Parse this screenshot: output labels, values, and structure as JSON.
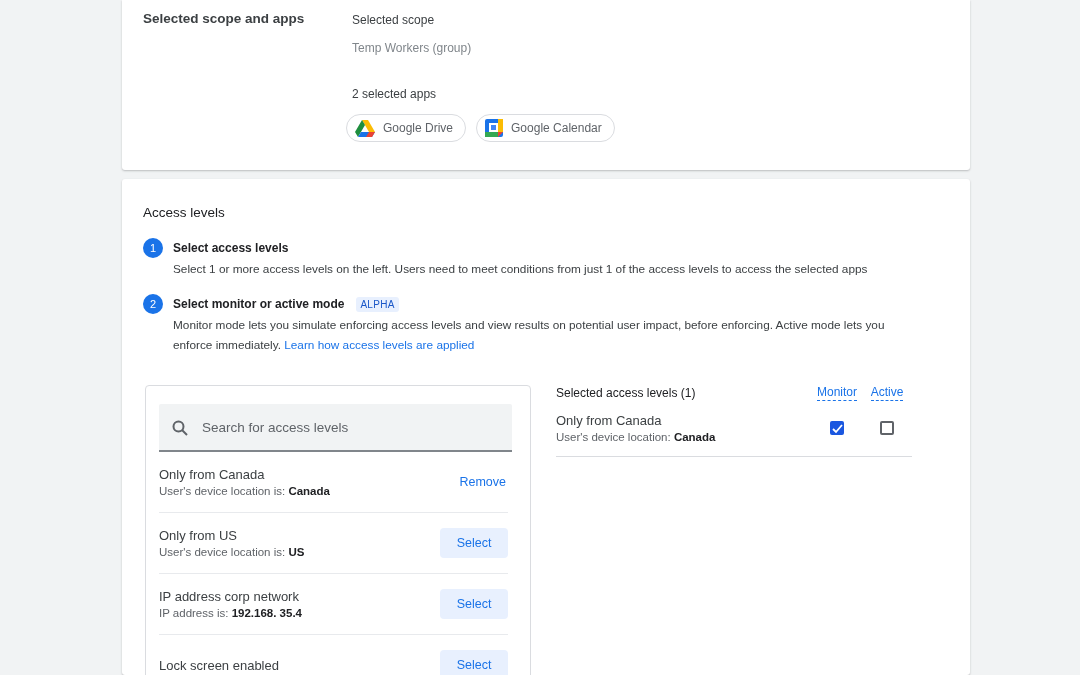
{
  "scope_card": {
    "title": "Selected scope and apps",
    "scope_label": "Selected scope",
    "scope_value": "Temp Workers (group)",
    "apps_label": "2 selected apps",
    "apps": [
      {
        "name": "Google Drive",
        "kind": "drive"
      },
      {
        "name": "Google Calendar",
        "kind": "calendar"
      }
    ]
  },
  "access_card": {
    "title": "Access levels",
    "steps": [
      {
        "number": "1",
        "title": "Select access levels",
        "text": "Select 1 or more access levels on the left. Users need to meet conditions from just 1 of the access levels to access the selected apps"
      },
      {
        "number": "2",
        "title": "Select monitor or active mode",
        "badge": "ALPHA",
        "text": "Monitor mode lets you simulate enforcing access levels and view results on potential user impact, before enforcing. Active mode lets you enforce immediately.",
        "link": "Learn how access levels are applied"
      }
    ],
    "search": {
      "placeholder": "Search for access levels"
    },
    "levels": [
      {
        "name": "Only from Canada",
        "condition_label": "User's device location is:",
        "condition_value": "Canada",
        "selected": true,
        "action": "Remove"
      },
      {
        "name": "Only from US",
        "condition_label": "User's device location is:",
        "condition_value": "US",
        "selected": false,
        "action": "Select"
      },
      {
        "name": "IP address corp network",
        "condition_label": "IP address is:",
        "condition_value": "192.168. 35.4",
        "selected": false,
        "action": "Select"
      },
      {
        "name": "Lock screen enabled",
        "selected": false,
        "action": "Select"
      }
    ],
    "selected_panel": {
      "title": "Selected access levels (1)",
      "columns": [
        "Monitor",
        "Active"
      ],
      "rows": [
        {
          "name": "Only from Canada",
          "condition_label": "User's device location:",
          "condition_value": "Canada",
          "monitor": true,
          "active": false
        }
      ]
    }
  }
}
